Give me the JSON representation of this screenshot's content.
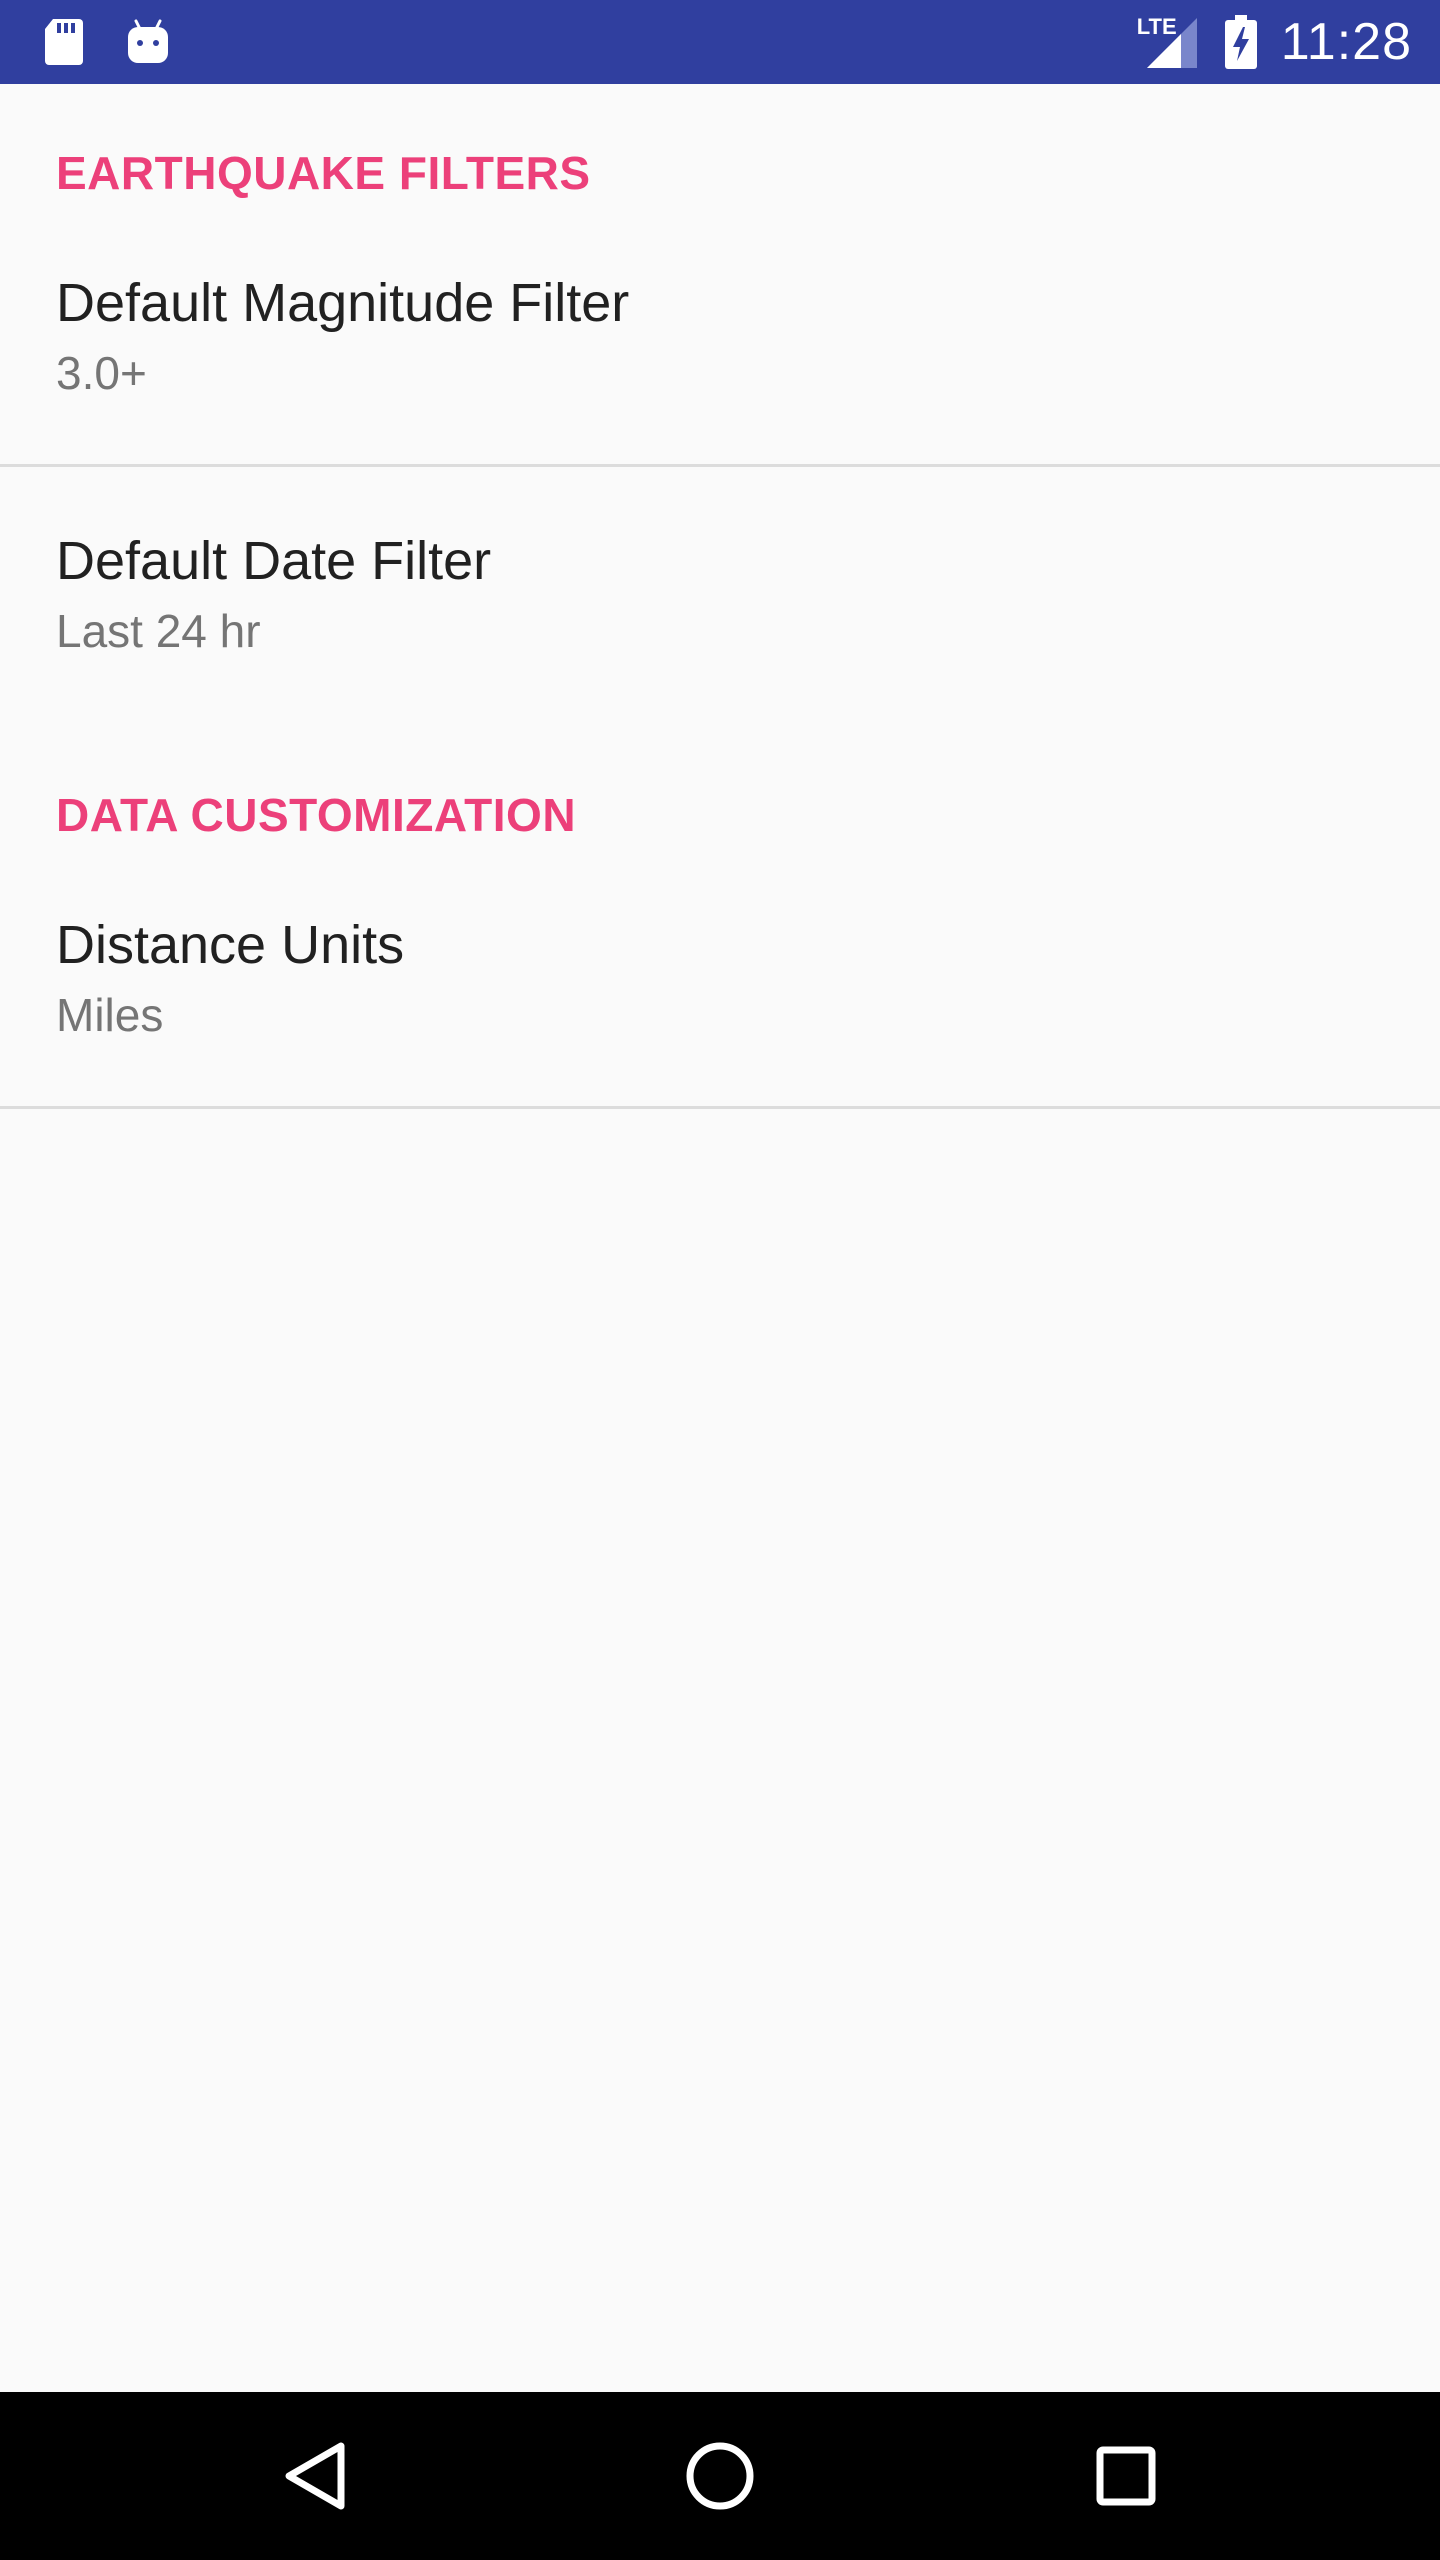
{
  "status_bar": {
    "time": "11:28",
    "network_label": "LTE",
    "left_icons": [
      "sd-card-icon",
      "android-debug-icon"
    ],
    "right_icons": [
      "signal-icon",
      "battery-charging-icon"
    ],
    "background_color": "#303f9f"
  },
  "settings": {
    "categories": [
      {
        "title": "EARTHQUAKE FILTERS",
        "items": [
          {
            "title": "Default Magnitude Filter",
            "summary": "3.0+"
          },
          {
            "title": "Default Date Filter",
            "summary": "Last 24 hr"
          }
        ]
      },
      {
        "title": "DATA CUSTOMIZATION",
        "items": [
          {
            "title": "Distance Units",
            "summary": "Miles"
          }
        ]
      }
    ],
    "accent_color": "#ec407a"
  },
  "nav_bar": {
    "buttons": [
      "back-icon",
      "home-icon",
      "recents-icon"
    ]
  }
}
